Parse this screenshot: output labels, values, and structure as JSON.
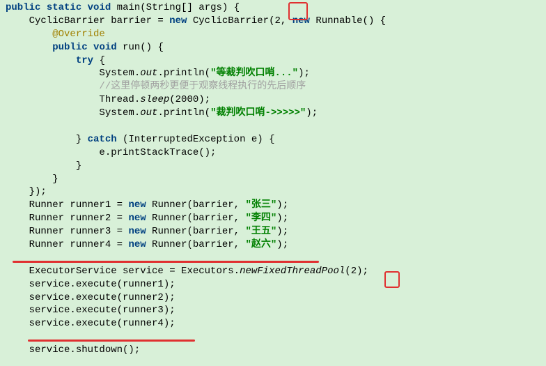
{
  "lines": {
    "l1_public": "public",
    "l1_static": "static",
    "l1_void": "void",
    "l1_text": " main(String[] args) {",
    "l2_a": "    CyclicBarrier barrier = ",
    "l2_new": "new",
    "l2_b": " CyclicBarrier(",
    "l2_num": "2",
    "l2_c": ", ",
    "l2_new2": "new",
    "l2_d": " Runnable() {",
    "l3_ann": "@Override",
    "l3_pre": "        ",
    "l4_pre": "        ",
    "l4_public": "public",
    "l4_void": "void",
    "l4_text": " run() {",
    "l5_pre": "            ",
    "l5_try": "try",
    "l5_text": " {",
    "l6_pre": "                System.",
    "l6_out": "out",
    "l6_mid": ".println(",
    "l6_str": "\"等裁判吹口哨...\"",
    "l6_end": ");",
    "l7_pre": "                ",
    "l7_com": "//这里停顿两秒更便于观察线程执行的先后顺序",
    "l8_pre": "                Thread.",
    "l8_sleep": "sleep",
    "l8_mid": "(",
    "l8_num": "2000",
    "l8_end": ");",
    "l9_pre": "                System.",
    "l9_out": "out",
    "l9_mid": ".println(",
    "l9_str": "\"裁判吹口哨->>>>>\"",
    "l9_end": ");",
    "blank": "",
    "l10_pre": "            } ",
    "l10_catch": "catch",
    "l10_text": " (InterruptedException e) {",
    "l11": "                e.printStackTrace();",
    "l12": "            }",
    "l13": "        }",
    "l14": "    });",
    "r1_a": "    Runner runner1 = ",
    "r1_new": "new",
    "r1_b": " Runner(barrier, ",
    "r1_str": "\"张三\"",
    "r1_end": ");",
    "r2_a": "    Runner runner2 = ",
    "r2_new": "new",
    "r2_b": " Runner(barrier, ",
    "r2_str": "\"李四\"",
    "r2_end": ");",
    "r3_a": "    Runner runner3 = ",
    "r3_new": "new",
    "r3_b": " Runner(barrier, ",
    "r3_str": "\"王五\"",
    "r3_end": ");",
    "r4_a": "    Runner runner4 = ",
    "r4_new": "new",
    "r4_b": " Runner(barrier, ",
    "r4_str": "\"赵六\"",
    "r4_end": ");",
    "e1_a": "    ExecutorService service = Executors.",
    "e1_m": "newFixedThreadPool",
    "e1_b": "(",
    "e1_num": "2",
    "e1_end": ");",
    "s1": "    service.execute(runner1);",
    "s2": "    service.execute(runner2);",
    "s3": "    service.execute(runner3);",
    "s4": "    service.execute(runner4);",
    "sd": "    service.shutdown();"
  }
}
